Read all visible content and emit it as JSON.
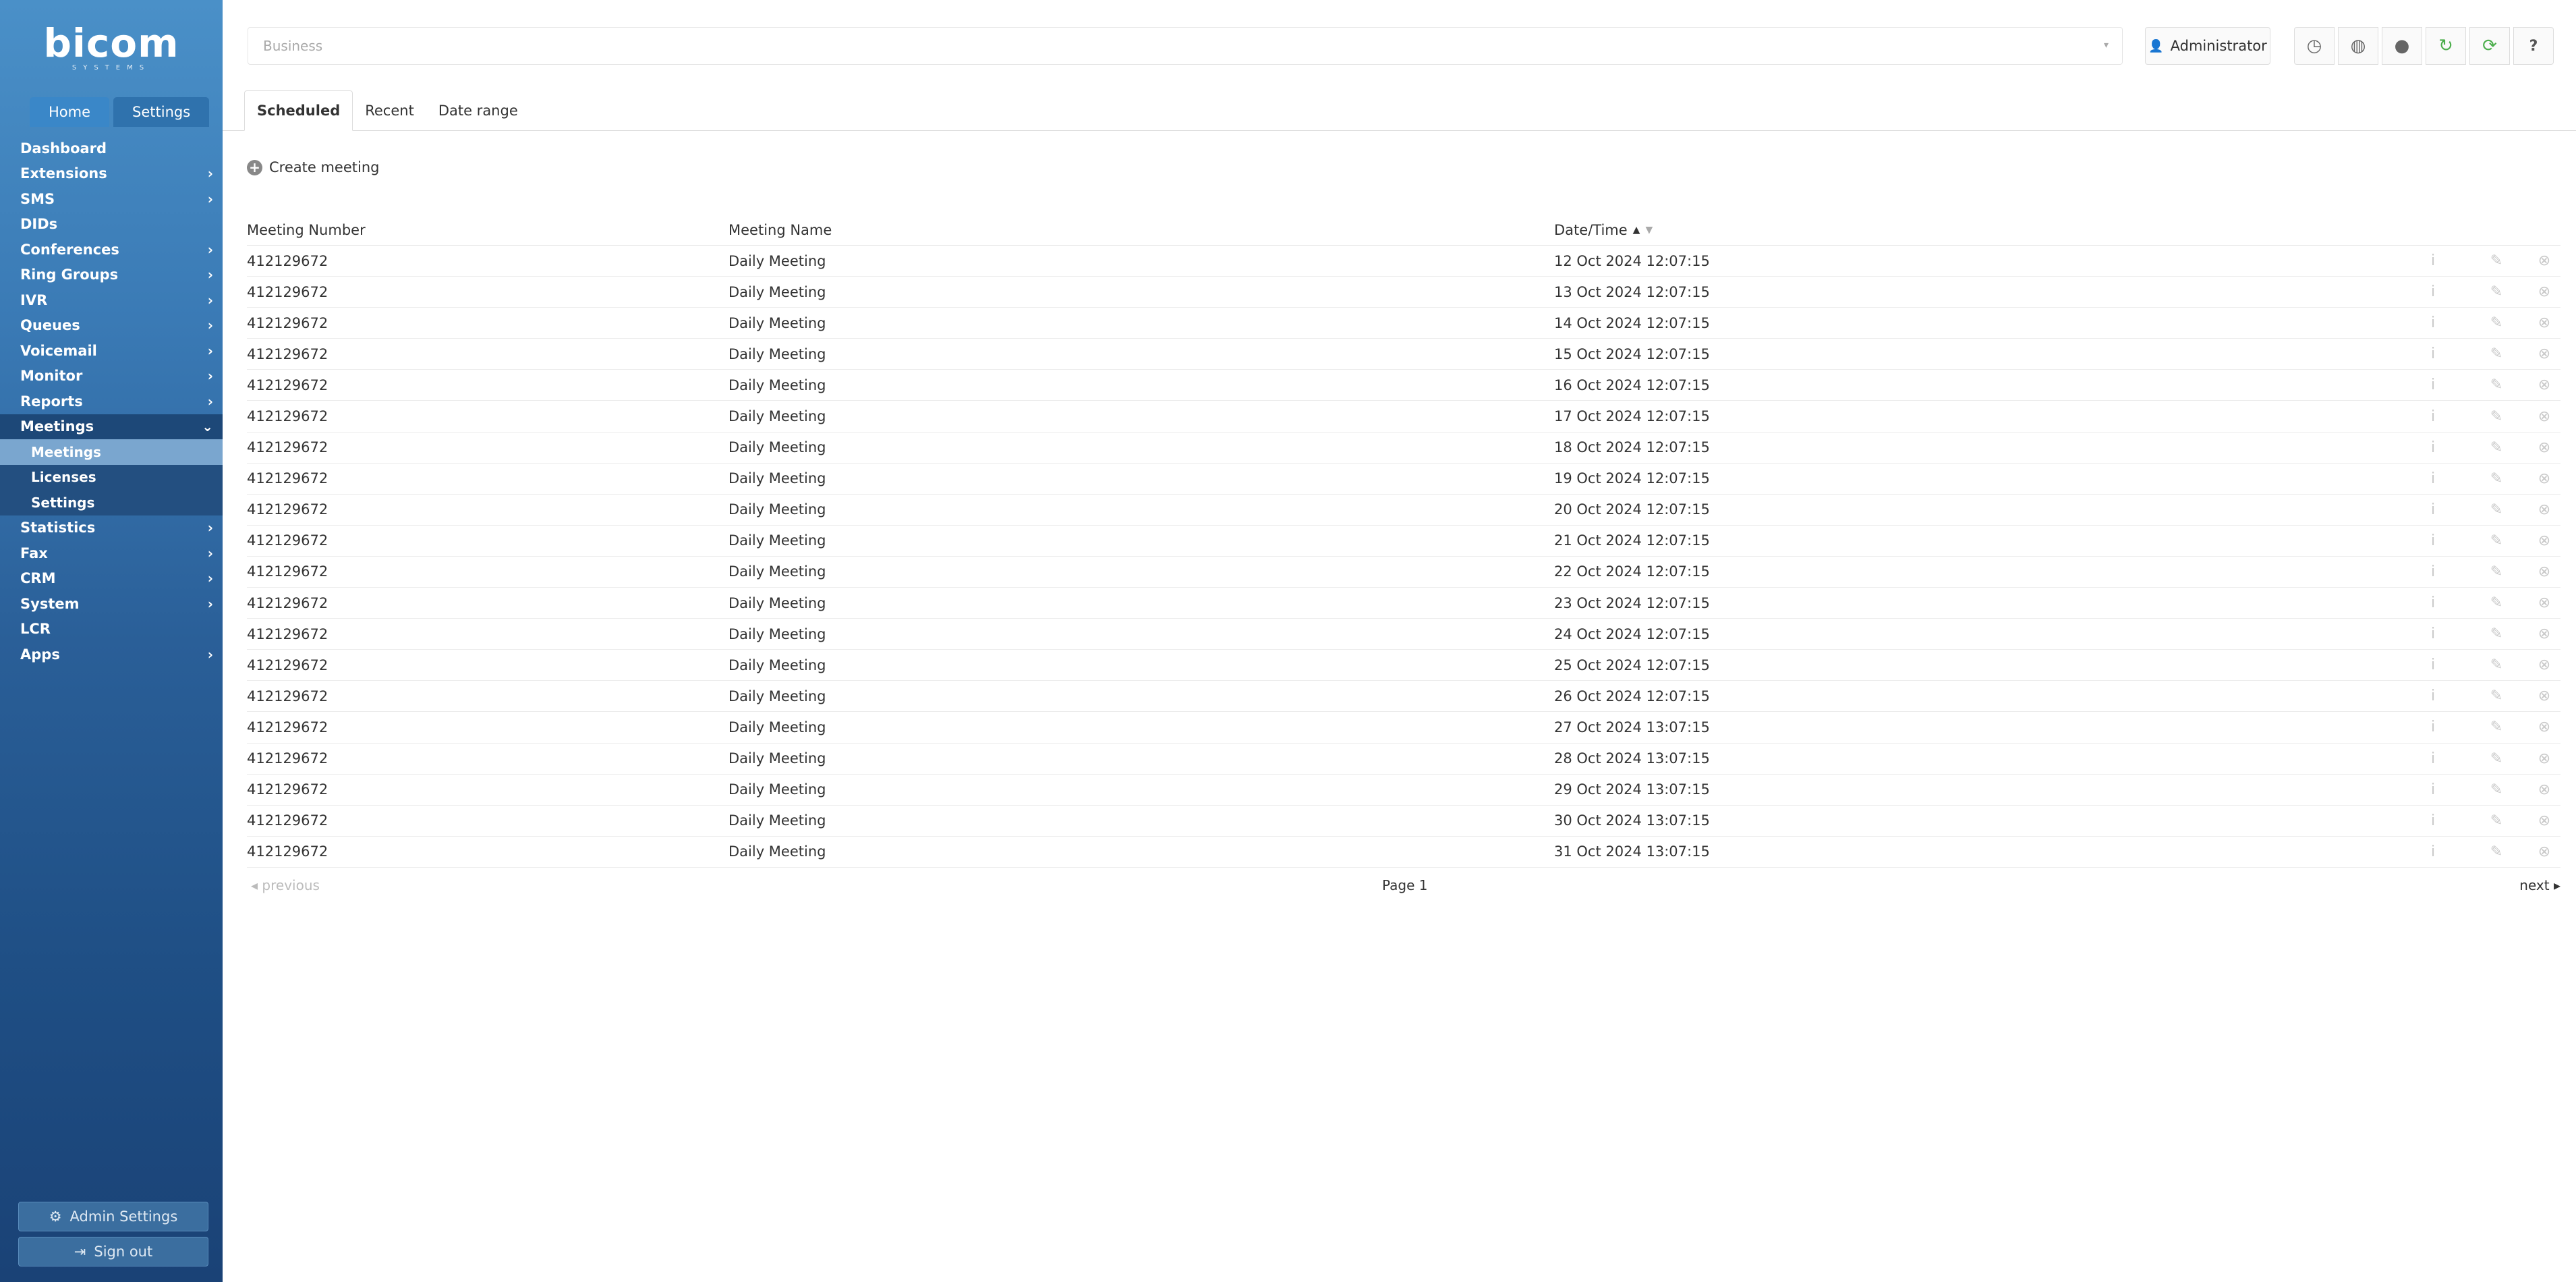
{
  "brand": {
    "name": "bicom",
    "sub": "SYSTEMS"
  },
  "top_tabs": {
    "home": "Home",
    "settings": "Settings"
  },
  "nav": {
    "items": [
      {
        "label": "Dashboard",
        "chev": ""
      },
      {
        "label": "Extensions",
        "chev": "›"
      },
      {
        "label": "SMS",
        "chev": "›"
      },
      {
        "label": "DIDs",
        "chev": ""
      },
      {
        "label": "Conferences",
        "chev": "›"
      },
      {
        "label": "Ring Groups",
        "chev": "›"
      },
      {
        "label": "IVR",
        "chev": "›"
      },
      {
        "label": "Queues",
        "chev": "›"
      },
      {
        "label": "Voicemail",
        "chev": "›"
      },
      {
        "label": "Monitor",
        "chev": "›"
      },
      {
        "label": "Reports",
        "chev": "›"
      },
      {
        "label": "Meetings",
        "chev": "⌄"
      },
      {
        "label": "Statistics",
        "chev": "›"
      },
      {
        "label": "Fax",
        "chev": "›"
      },
      {
        "label": "CRM",
        "chev": "›"
      },
      {
        "label": "System",
        "chev": "›"
      },
      {
        "label": "LCR",
        "chev": ""
      },
      {
        "label": "Apps",
        "chev": "›"
      }
    ],
    "meetings_sub": [
      "Meetings",
      "Licenses",
      "Settings"
    ]
  },
  "sidebar_buttons": {
    "admin_settings": "Admin Settings",
    "sign_out": "Sign out"
  },
  "topbar": {
    "business_placeholder": "Business",
    "user": "Administrator",
    "help": "?"
  },
  "tabs": {
    "scheduled": "Scheduled",
    "recent": "Recent",
    "date_range": "Date range"
  },
  "create_meeting": "Create meeting",
  "table": {
    "headers": {
      "number": "Meeting Number",
      "name": "Meeting Name",
      "datetime": "Date/Time"
    },
    "rows": [
      {
        "number": "412129672",
        "name": "Daily Meeting",
        "datetime": "12 Oct 2024 12:07:15"
      },
      {
        "number": "412129672",
        "name": "Daily Meeting",
        "datetime": "13 Oct 2024 12:07:15"
      },
      {
        "number": "412129672",
        "name": "Daily Meeting",
        "datetime": "14 Oct 2024 12:07:15"
      },
      {
        "number": "412129672",
        "name": "Daily Meeting",
        "datetime": "15 Oct 2024 12:07:15"
      },
      {
        "number": "412129672",
        "name": "Daily Meeting",
        "datetime": "16 Oct 2024 12:07:15"
      },
      {
        "number": "412129672",
        "name": "Daily Meeting",
        "datetime": "17 Oct 2024 12:07:15"
      },
      {
        "number": "412129672",
        "name": "Daily Meeting",
        "datetime": "18 Oct 2024 12:07:15"
      },
      {
        "number": "412129672",
        "name": "Daily Meeting",
        "datetime": "19 Oct 2024 12:07:15"
      },
      {
        "number": "412129672",
        "name": "Daily Meeting",
        "datetime": "20 Oct 2024 12:07:15"
      },
      {
        "number": "412129672",
        "name": "Daily Meeting",
        "datetime": "21 Oct 2024 12:07:15"
      },
      {
        "number": "412129672",
        "name": "Daily Meeting",
        "datetime": "22 Oct 2024 12:07:15"
      },
      {
        "number": "412129672",
        "name": "Daily Meeting",
        "datetime": "23 Oct 2024 12:07:15"
      },
      {
        "number": "412129672",
        "name": "Daily Meeting",
        "datetime": "24 Oct 2024 12:07:15"
      },
      {
        "number": "412129672",
        "name": "Daily Meeting",
        "datetime": "25 Oct 2024 12:07:15"
      },
      {
        "number": "412129672",
        "name": "Daily Meeting",
        "datetime": "26 Oct 2024 12:07:15"
      },
      {
        "number": "412129672",
        "name": "Daily Meeting",
        "datetime": "27 Oct 2024 13:07:15"
      },
      {
        "number": "412129672",
        "name": "Daily Meeting",
        "datetime": "28 Oct 2024 13:07:15"
      },
      {
        "number": "412129672",
        "name": "Daily Meeting",
        "datetime": "29 Oct 2024 13:07:15"
      },
      {
        "number": "412129672",
        "name": "Daily Meeting",
        "datetime": "30 Oct 2024 13:07:15"
      },
      {
        "number": "412129672",
        "name": "Daily Meeting",
        "datetime": "31 Oct 2024 13:07:15"
      }
    ]
  },
  "pager": {
    "prev": "previous",
    "page": "Page 1",
    "next": "next"
  },
  "colors": {
    "sidebar_top": "#4a90c8",
    "sidebar_bottom": "#1a4276",
    "refresh_green": "#4cae4c"
  }
}
